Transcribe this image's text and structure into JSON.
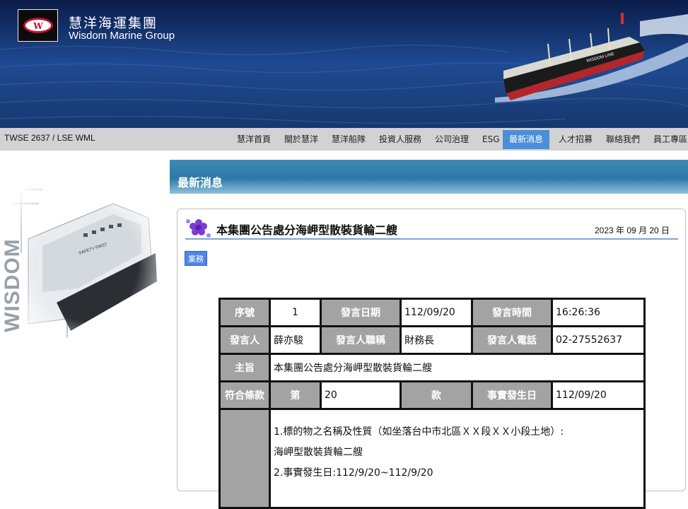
{
  "brand": {
    "name_zh": "慧洋海運集團",
    "name_en": "Wisdom Marine Group",
    "logo_letter": "W",
    "side_watermark": "WISDOM"
  },
  "ticker": "TWSE 2637 / LSE WML",
  "nav": {
    "items": [
      {
        "label": "慧洋首頁",
        "active": false
      },
      {
        "label": "關於慧洋",
        "active": false
      },
      {
        "label": "慧洋船隊",
        "active": false
      },
      {
        "label": "投資人服務",
        "active": false
      },
      {
        "label": "公司治理",
        "active": false
      },
      {
        "label": "ESG",
        "active": false
      },
      {
        "label": "最新消息",
        "active": true
      },
      {
        "label": "人才招募",
        "active": false
      },
      {
        "label": "聯絡我們",
        "active": false
      },
      {
        "label": "員工專區",
        "active": false
      }
    ]
  },
  "section_title": "最新消息",
  "article": {
    "icon": "flower-icon",
    "title": "本集團公告處分海岬型散裝貨輪二艘",
    "date": "2023 年 09 月 20 日",
    "tag": "業務"
  },
  "table": {
    "seq_label": "序號",
    "seq_value": "1",
    "date_label": "發言日期",
    "date_value": "112/09/20",
    "time_label": "發言時間",
    "time_value": "16:26:36",
    "speaker_label": "發言人",
    "speaker_value": "薛亦駿",
    "title_label": "發言人職稱",
    "title_value": "財務長",
    "phone_label": "發言人電話",
    "phone_value": "02-27552637",
    "subject_label": "主旨",
    "subject_value": "本集團公告處分海岬型散裝貨輪二艘",
    "clause_label": "符合條款",
    "clause_prefix": "第",
    "clause_value": "20",
    "clause_suffix": "款",
    "occur_label": "事實發生日",
    "occur_value": "112/09/20",
    "desc_lines": [
      "1.標的物之名稱及性質（如坐落台中市北區ＸＸ段ＸＸ小段土地）:",
      "海岬型散裝貨輪二艘",
      "2.事實發生日:112/9/20~112/9/20"
    ]
  },
  "colors": {
    "nav_active": "#4a8fd8",
    "header_bar": "#2d79a6",
    "table_header": "#a3a3a3",
    "tag_bg": "#4f86e6",
    "logo_red": "#c8102e"
  }
}
